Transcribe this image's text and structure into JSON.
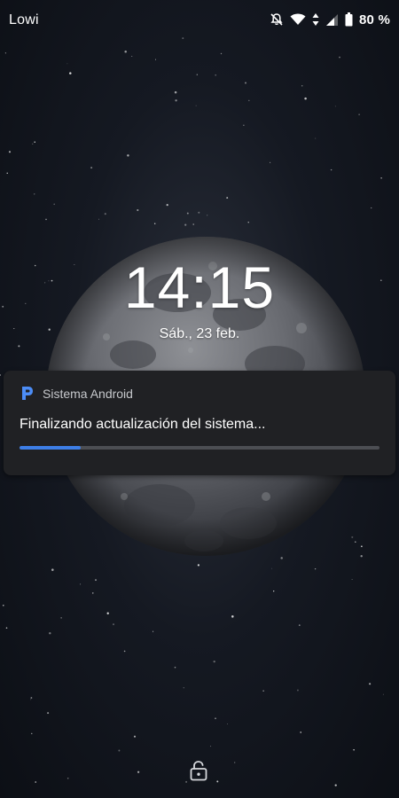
{
  "status_bar": {
    "carrier": "Lowi",
    "battery_text": "80 %",
    "icons": [
      "notifications-off-icon",
      "wifi-icon",
      "data-arrows-icon",
      "cell-signal-icon",
      "battery-icon"
    ]
  },
  "lock_screen": {
    "time": "14:15",
    "date": "Sáb., 23 feb."
  },
  "notification": {
    "app_name": "Sistema Android",
    "app_icon": "android-p-logo-icon",
    "title": "Finalizando actualización del sistema...",
    "progress": 0.17
  },
  "bottom": {
    "icon": "lock-open-icon"
  },
  "colors": {
    "accent": "#3d7ee6",
    "notification_bg": "#202124",
    "progress_track": "#4c4e53"
  }
}
